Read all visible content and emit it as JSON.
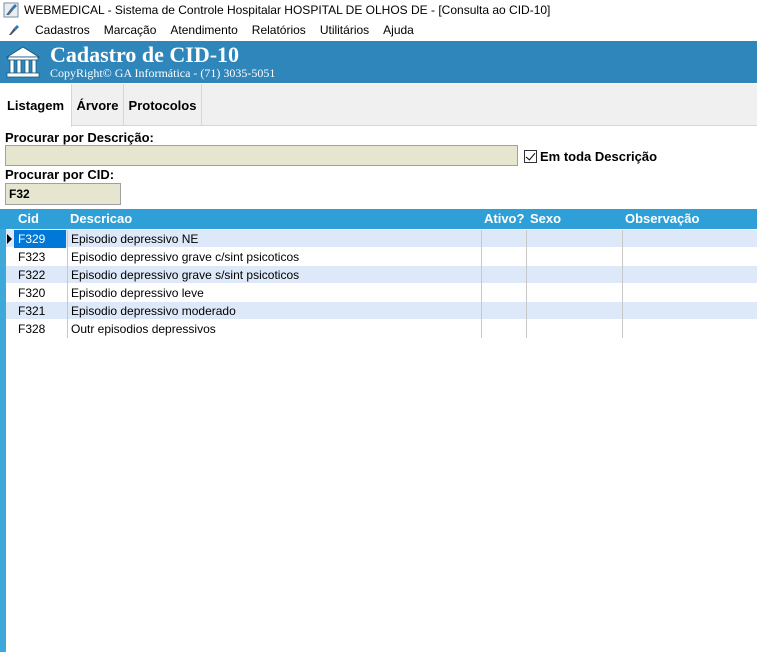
{
  "window": {
    "title": "WEBMEDICAL - Sistema de Controle Hospitalar HOSPITAL DE OLHOS DE - [Consulta ao CID-10]"
  },
  "menu": {
    "items": [
      {
        "label": "Cadastros"
      },
      {
        "label": "Marcação"
      },
      {
        "label": "Atendimento"
      },
      {
        "label": "Relatórios"
      },
      {
        "label": "Utilitários"
      },
      {
        "label": "Ajuda"
      }
    ]
  },
  "banner": {
    "title": "Cadastro de CID-10",
    "subtitle": "CopyRight© GA Informática - (71) 3035-5051",
    "color": "#2f86bb"
  },
  "tabs": [
    {
      "label": "Listagem",
      "active": true
    },
    {
      "label": "Árvore",
      "active": false
    },
    {
      "label": "Protocolos",
      "active": false
    }
  ],
  "search": {
    "desc_label": "Procurar por Descrição:",
    "desc_value": "",
    "whole_desc_label": "Em toda Descrição",
    "whole_desc_checked": true,
    "cid_label": "Procurar por CID:",
    "cid_value": "F32"
  },
  "grid": {
    "header_color": "#2f9fd7",
    "columns": [
      "Cid",
      "Descricao",
      "Ativo?",
      "Sexo",
      "Observação"
    ],
    "rows": [
      {
        "cid": "F329",
        "descricao": "Episodio depressivo NE",
        "ativo": "",
        "sexo": "",
        "obs": "",
        "selected": true
      },
      {
        "cid": "F323",
        "descricao": "Episodio depressivo grave c/sint psicoticos",
        "ativo": "",
        "sexo": "",
        "obs": ""
      },
      {
        "cid": "F322",
        "descricao": "Episodio depressivo grave s/sint psicoticos",
        "ativo": "",
        "sexo": "",
        "obs": ""
      },
      {
        "cid": "F320",
        "descricao": "Episodio depressivo leve",
        "ativo": "",
        "sexo": "",
        "obs": ""
      },
      {
        "cid": "F321",
        "descricao": "Episodio depressivo moderado",
        "ativo": "",
        "sexo": "",
        "obs": ""
      },
      {
        "cid": "F328",
        "descricao": "Outr episodios depressivos",
        "ativo": "",
        "sexo": "",
        "obs": ""
      }
    ]
  }
}
